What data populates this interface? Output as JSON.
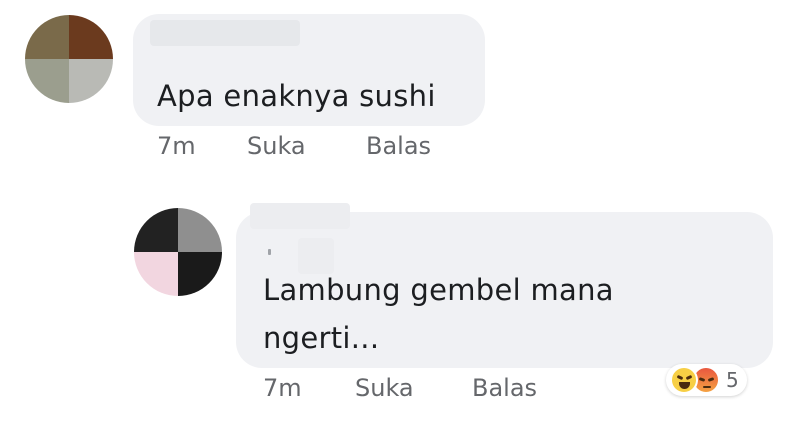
{
  "comments": [
    {
      "text": "Apa enaknya sushi",
      "time": "7m",
      "like_label": "Suka",
      "reply_label": "Balas"
    },
    {
      "text_line1": "Lambung gembel mana",
      "text_line2": "ngerti...",
      "time": "7m",
      "like_label": "Suka",
      "reply_label": "Balas",
      "reactions": {
        "icons": [
          "haha-icon",
          "angry-icon"
        ],
        "count": "5"
      }
    }
  ],
  "colors": {
    "bubble": "#f0f1f4",
    "text": "#1c1e21",
    "meta": "#65676b"
  }
}
